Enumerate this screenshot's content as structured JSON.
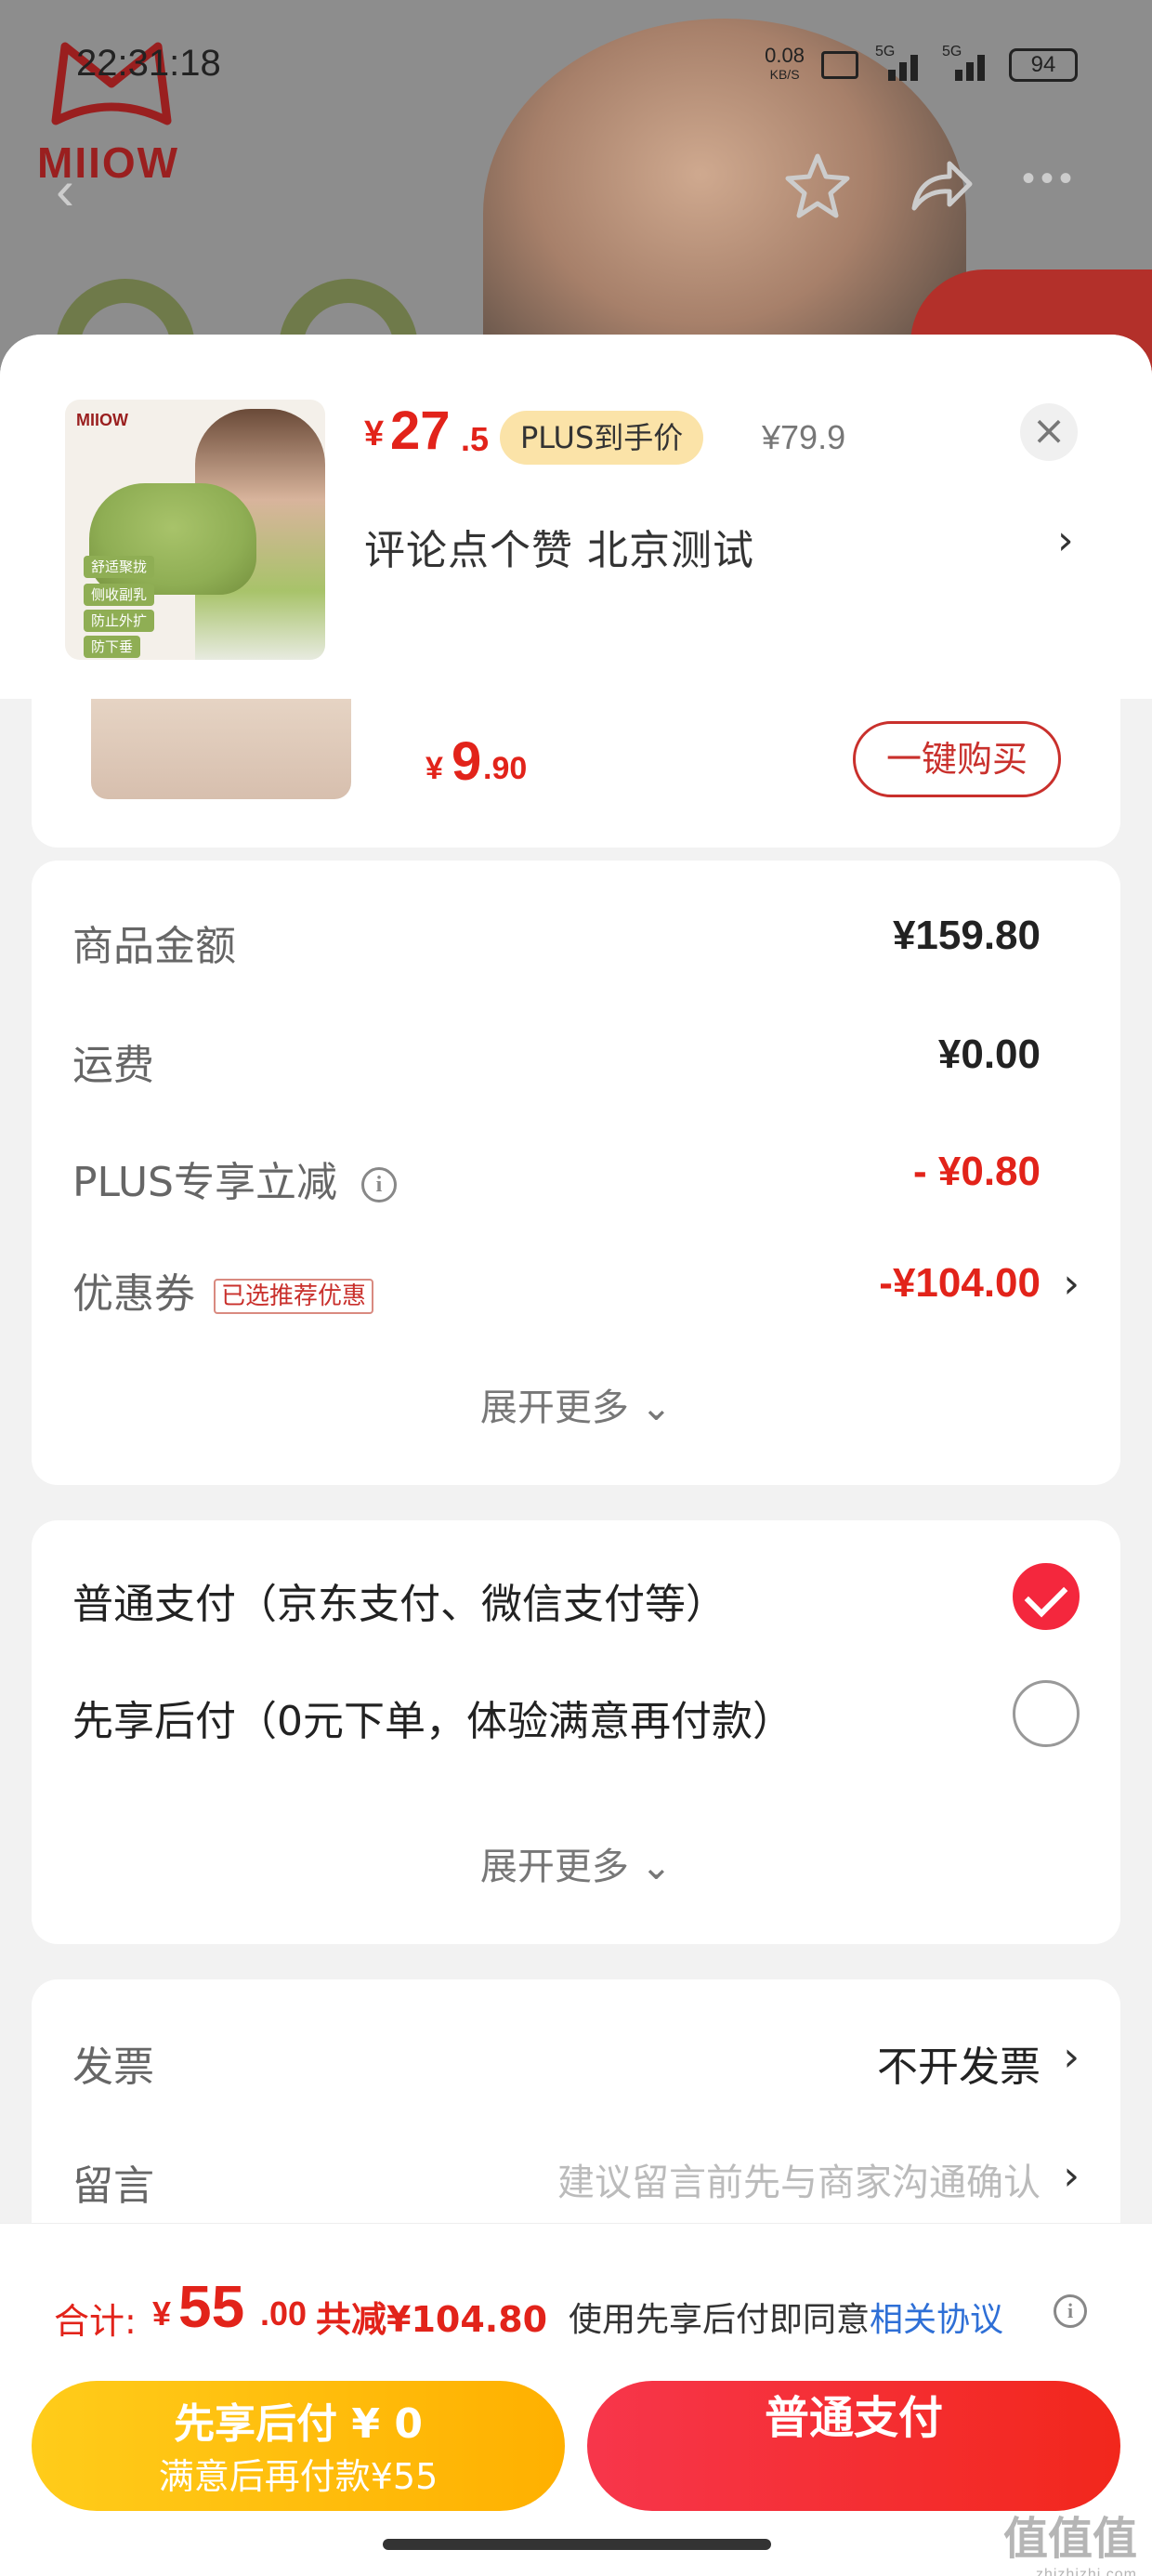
{
  "status_bar": {
    "time": "22:31:18",
    "net_speed": "0.08",
    "net_unit": "KB/S",
    "signal1": "5G",
    "signal2": "5G",
    "battery": "94"
  },
  "brand": {
    "logo_text": "MIIOW",
    "thumb_logo": "MIIOW",
    "thumb_tags": [
      "舒适聚拢",
      "侧收副乳",
      "防止外扩",
      "防下垂"
    ]
  },
  "product": {
    "currency": "¥",
    "price_int": "27",
    "price_dec": ".5",
    "plus_badge": "PLUS到手价",
    "original_price": "¥79.9",
    "spec": "评论点个赞  北京测试",
    "chevron": "›",
    "close": "×"
  },
  "recommend": {
    "currency": "¥",
    "price_int": "9",
    "price_dec": ".90",
    "buy_label": "一键购买"
  },
  "price_detail": {
    "rows": [
      {
        "label": "商品金额",
        "value": "¥159.80"
      },
      {
        "label": "运费",
        "value": "¥0.00"
      },
      {
        "label": "PLUS专享立减",
        "value": "- ¥0.80"
      },
      {
        "label": "优惠券",
        "tag": "已选推荐优惠",
        "value": "-¥104.00"
      }
    ],
    "expand": "展开更多 ⌄"
  },
  "payment": {
    "options": [
      {
        "label": "普通支付（京东支付、微信支付等）",
        "selected": true
      },
      {
        "label": "先享后付（0元下单，体验满意再付款）",
        "selected": false
      }
    ],
    "expand": "展开更多 ⌄"
  },
  "invoice": {
    "rows": [
      {
        "label": "发票",
        "value": "不开发票"
      },
      {
        "label": "留言",
        "placeholder": "建议留言前先与商家沟通确认"
      }
    ]
  },
  "totals": {
    "label": "合计:",
    "currency": "¥",
    "int": "55",
    "dec": ".00",
    "saving": "共减¥104.80",
    "agree_prefix": "使用先享后付即同意",
    "agree_link": "相关协议"
  },
  "actions": {
    "later_line1": "先享后付 ¥ 0",
    "later_line2": "满意后再付款¥55",
    "pay": "普通支付"
  },
  "watermark": {
    "main": "值值值",
    "sub": "zhizhizhi.com"
  },
  "colors": {
    "accent": "#e2231a",
    "plus_badge": "#fbe3a8",
    "later_btn": "#ffb000",
    "pay_btn": "#f2271c",
    "link": "#2e6fd6"
  }
}
